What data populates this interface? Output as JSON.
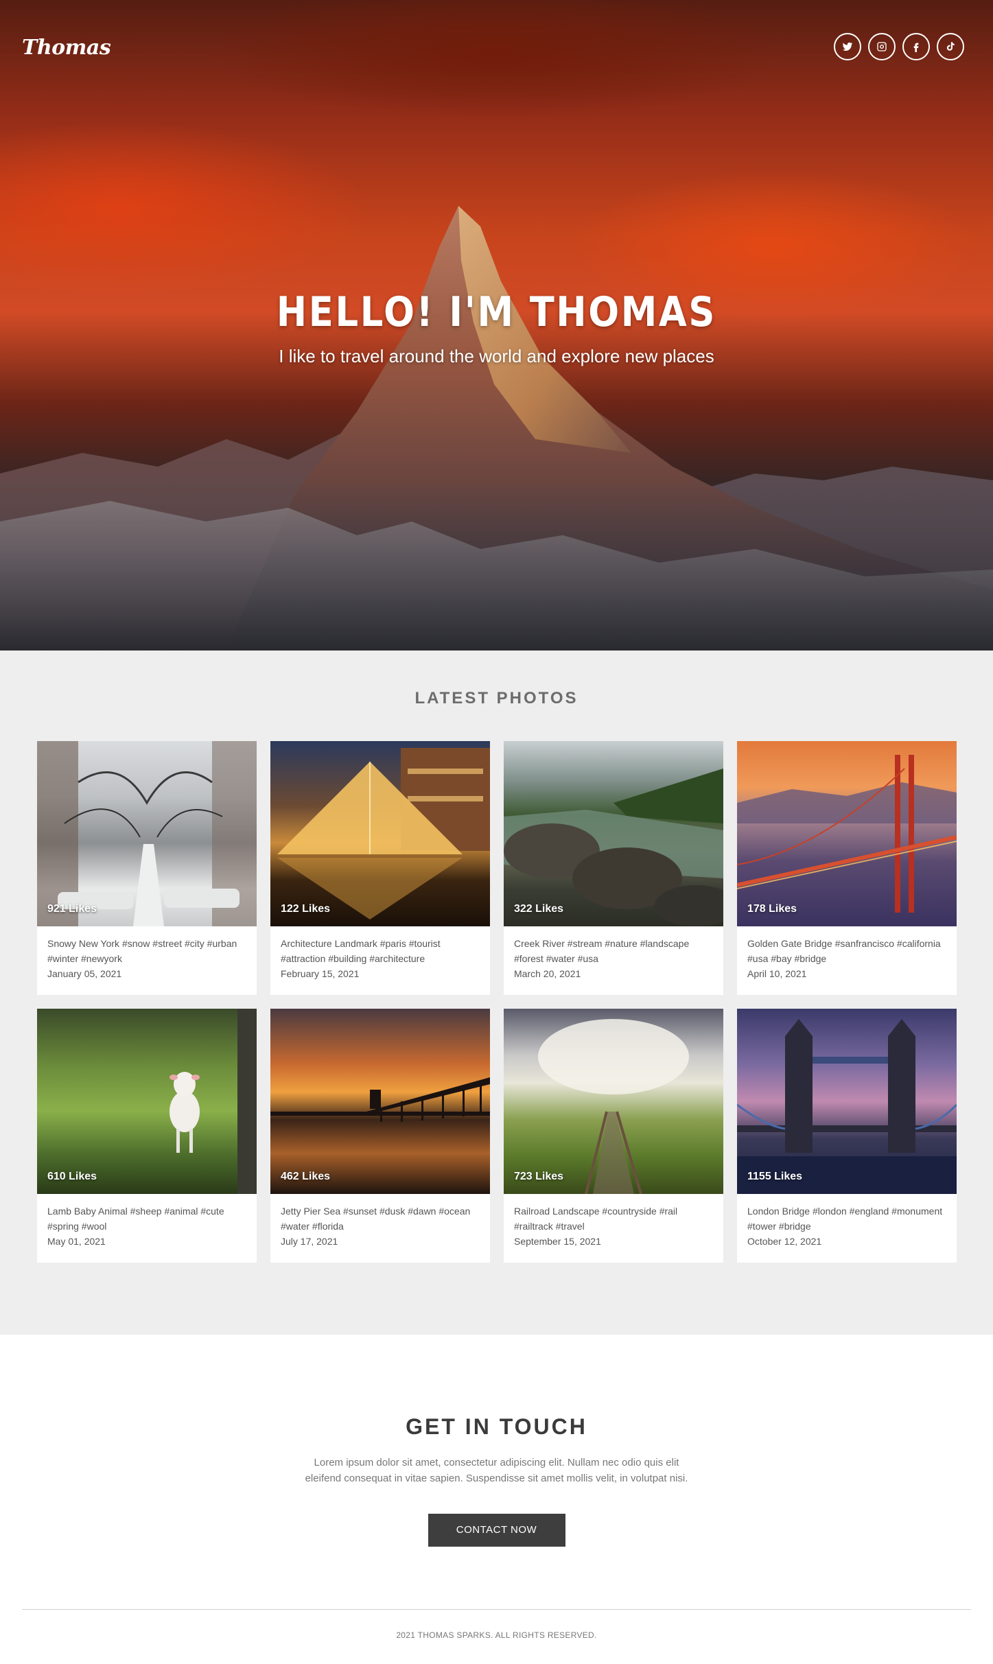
{
  "header": {
    "logo": "Thomas",
    "social": [
      {
        "icon": "twitter-icon"
      },
      {
        "icon": "instagram-icon"
      },
      {
        "icon": "facebook-icon"
      },
      {
        "icon": "tiktok-icon"
      }
    ]
  },
  "hero": {
    "title": "HELLO! I'M THOMAS",
    "subtitle": "I like to travel around the world and explore new places"
  },
  "photos": {
    "section_title": "LATEST PHOTOS",
    "items": [
      {
        "likes": "921 Likes",
        "caption": "Snowy New York #snow #street #city #urban #winter #newyork",
        "date": "January 05, 2021",
        "image": "snowy-street"
      },
      {
        "likes": "122 Likes",
        "caption": "Architecture Landmark #paris #tourist #attraction #building #architecture",
        "date": "February 15, 2021",
        "image": "louvre-pyramid"
      },
      {
        "likes": "322 Likes",
        "caption": "Creek River #stream #nature #landscape #forest #water #usa",
        "date": "March 20, 2021",
        "image": "creek-river"
      },
      {
        "likes": "178 Likes",
        "caption": "Golden Gate Bridge #sanfrancisco #california #usa #bay #bridge",
        "date": "April 10, 2021",
        "image": "golden-gate-bridge"
      },
      {
        "likes": "610 Likes",
        "caption": "Lamb Baby Animal #sheep #animal #cute #spring #wool",
        "date": "May 01, 2021",
        "image": "lamb"
      },
      {
        "likes": "462 Likes",
        "caption": "Jetty Pier Sea #sunset #dusk #dawn #ocean #water #florida",
        "date": "July 17, 2021",
        "image": "jetty-pier"
      },
      {
        "likes": "723 Likes",
        "caption": "Railroad Landscape #countryside #rail #railtrack #travel",
        "date": "September 15, 2021",
        "image": "railroad"
      },
      {
        "likes": "1155 Likes",
        "caption": "London Bridge #london #england #monument #tower #bridge",
        "date": "October 12, 2021",
        "image": "tower-bridge"
      }
    ]
  },
  "contact": {
    "title": "GET IN TOUCH",
    "text": "Lorem ipsum dolor sit amet, consectetur adipiscing elit. Nullam nec odio quis elit eleifend consequat in vitae sapien. Suspendisse sit amet mollis velit, in volutpat nisi.",
    "button": "CONTACT NOW"
  },
  "footer": {
    "copyright": "2021 THOMAS SPARKS. ALL RIGHTS RESERVED."
  }
}
